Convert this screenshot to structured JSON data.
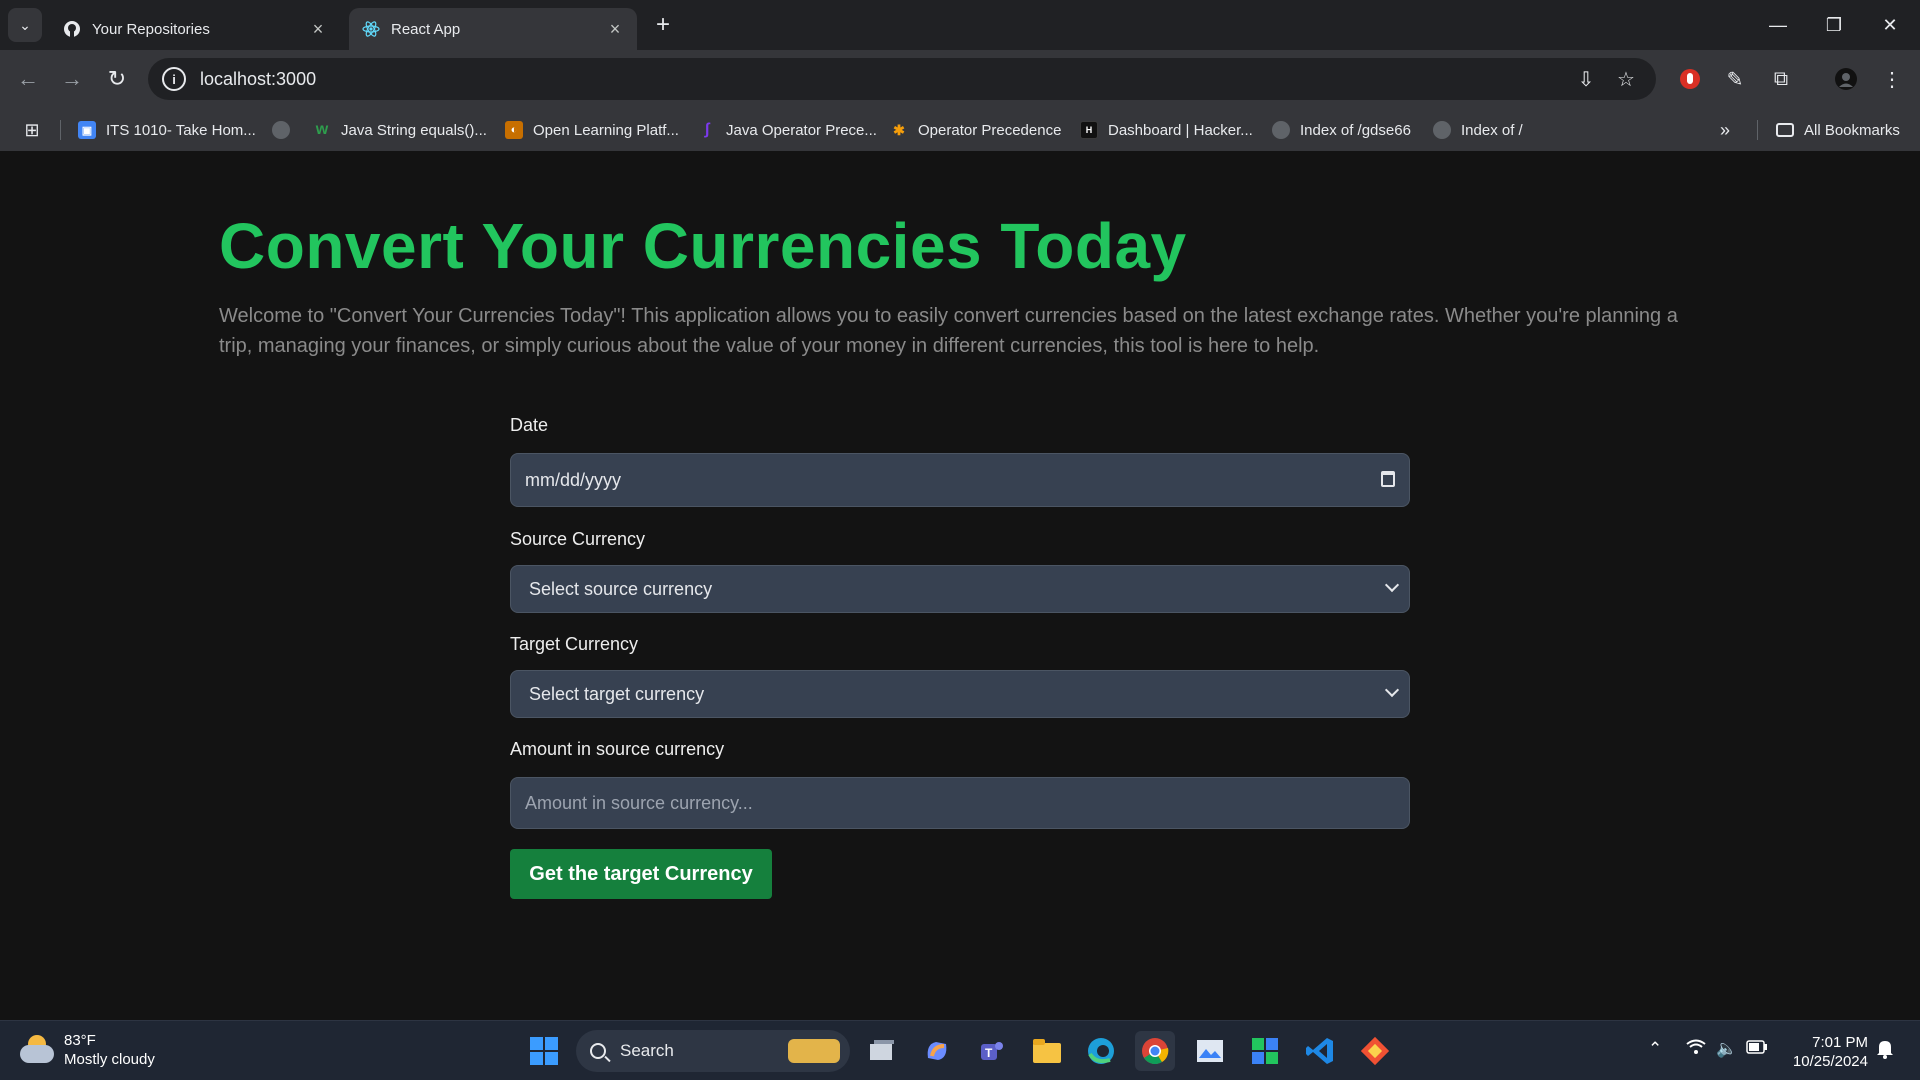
{
  "browser": {
    "tabs": [
      {
        "title": "Your Repositories",
        "active": false
      },
      {
        "title": "React App",
        "active": true
      }
    ],
    "url": "localhost:3000",
    "bookmarks": [
      {
        "label": "ITS 1010- Take Hom...",
        "color": "#4285f4"
      },
      {
        "label": "",
        "color": "#5f6368"
      },
      {
        "label": "Java String equals()...",
        "color": "#2e9e4d"
      },
      {
        "label": "Open Learning Platf...",
        "color": "#c76f00"
      },
      {
        "label": "Java Operator Prece...",
        "color": "#7c3aed"
      },
      {
        "label": "Operator Precedence",
        "color": "#f59e0b"
      },
      {
        "label": "Dashboard | Hacker...",
        "color": "#111111"
      },
      {
        "label": "Index of /gdse66",
        "color": "#5f6368"
      },
      {
        "label": "Index of /",
        "color": "#5f6368"
      }
    ],
    "all_bookmarks": "All Bookmarks"
  },
  "page": {
    "heading": "Convert Your Currencies Today",
    "intro": "Welcome to \"Convert Your Currencies Today\"! This application allows you to easily convert currencies based on the latest exchange rates. Whether you're planning a trip, managing your finances, or simply curious about the value of your money in different currencies, this tool is here to help.",
    "form": {
      "date_label": "Date",
      "date_placeholder": "mm/dd/yyyy",
      "source_label": "Source Currency",
      "source_selected": "Select source currency",
      "target_label": "Target Currency",
      "target_selected": "Select target currency",
      "amount_label": "Amount in source currency",
      "amount_placeholder": "Amount in source currency...",
      "submit_label": "Get the target Currency"
    },
    "colors": {
      "heading": "#22c55e",
      "button": "#15803d",
      "field_bg": "#374151"
    }
  },
  "taskbar": {
    "weather_temp": "83°F",
    "weather_desc": "Mostly cloudy",
    "search_label": "Search",
    "time": "7:01 PM",
    "date": "10/25/2024"
  }
}
